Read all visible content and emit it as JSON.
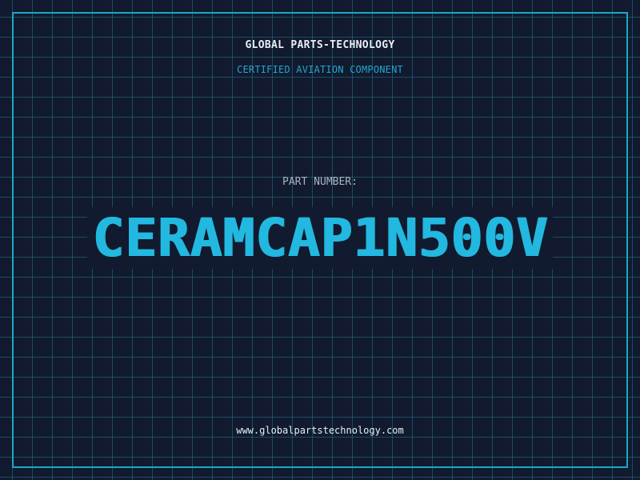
{
  "header": {
    "company": "GLOBAL PARTS-TECHNOLOGY",
    "subtitle": "CERTIFIED AVIATION COMPONENT"
  },
  "part": {
    "label": "PART NUMBER:",
    "number": "CERAMCAP1N500V"
  },
  "footer": {
    "website": "www.globalpartstechnology.com"
  },
  "colors": {
    "background": "#111a2e",
    "grid": "#288caa",
    "accent": "#22b8e0",
    "text": "#e8eef5"
  }
}
